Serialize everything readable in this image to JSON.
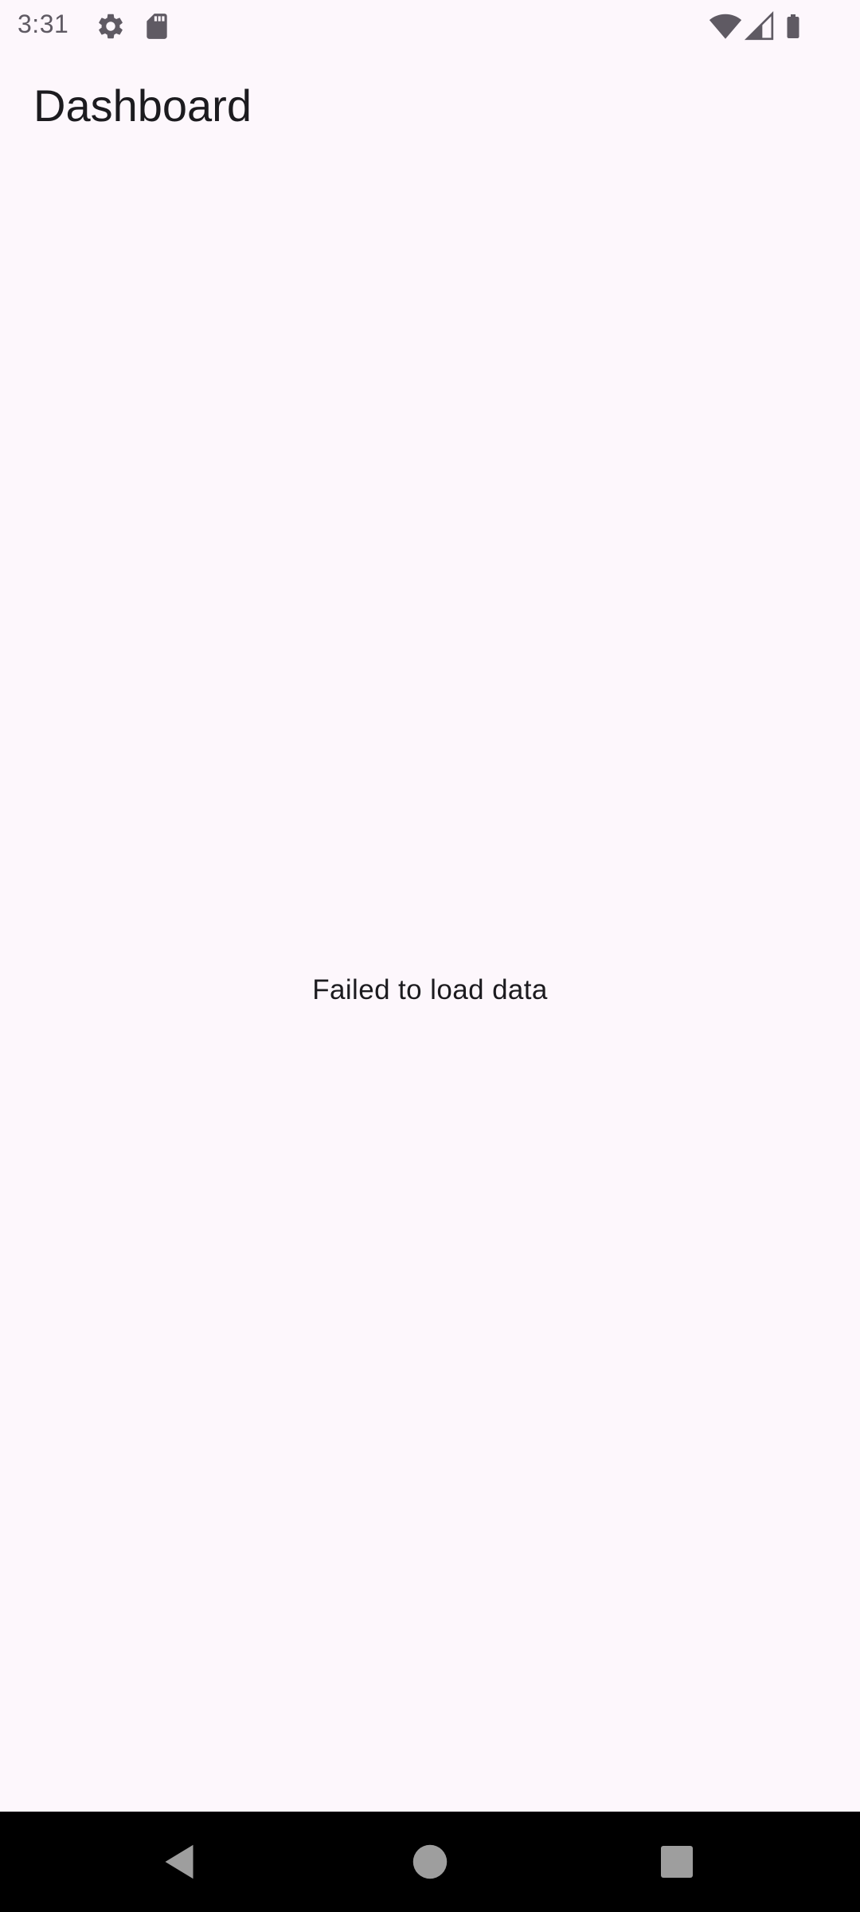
{
  "status_bar": {
    "time": "3:31",
    "icons_left": [
      "gear-icon",
      "sd-card-icon"
    ],
    "icons_right": [
      "wifi-icon",
      "cell-signal-icon",
      "battery-icon"
    ],
    "icon_color": "#5F5A63"
  },
  "app_bar": {
    "title": "Dashboard"
  },
  "content": {
    "error_message": "Failed to load data"
  },
  "nav_bar": {
    "buttons": [
      "back-icon",
      "home-icon",
      "recents-icon"
    ],
    "button_color": "#9E9E9E"
  },
  "colors": {
    "background": "#FDF7FC",
    "text": "#1C1B1F",
    "nav_background": "#000000"
  }
}
